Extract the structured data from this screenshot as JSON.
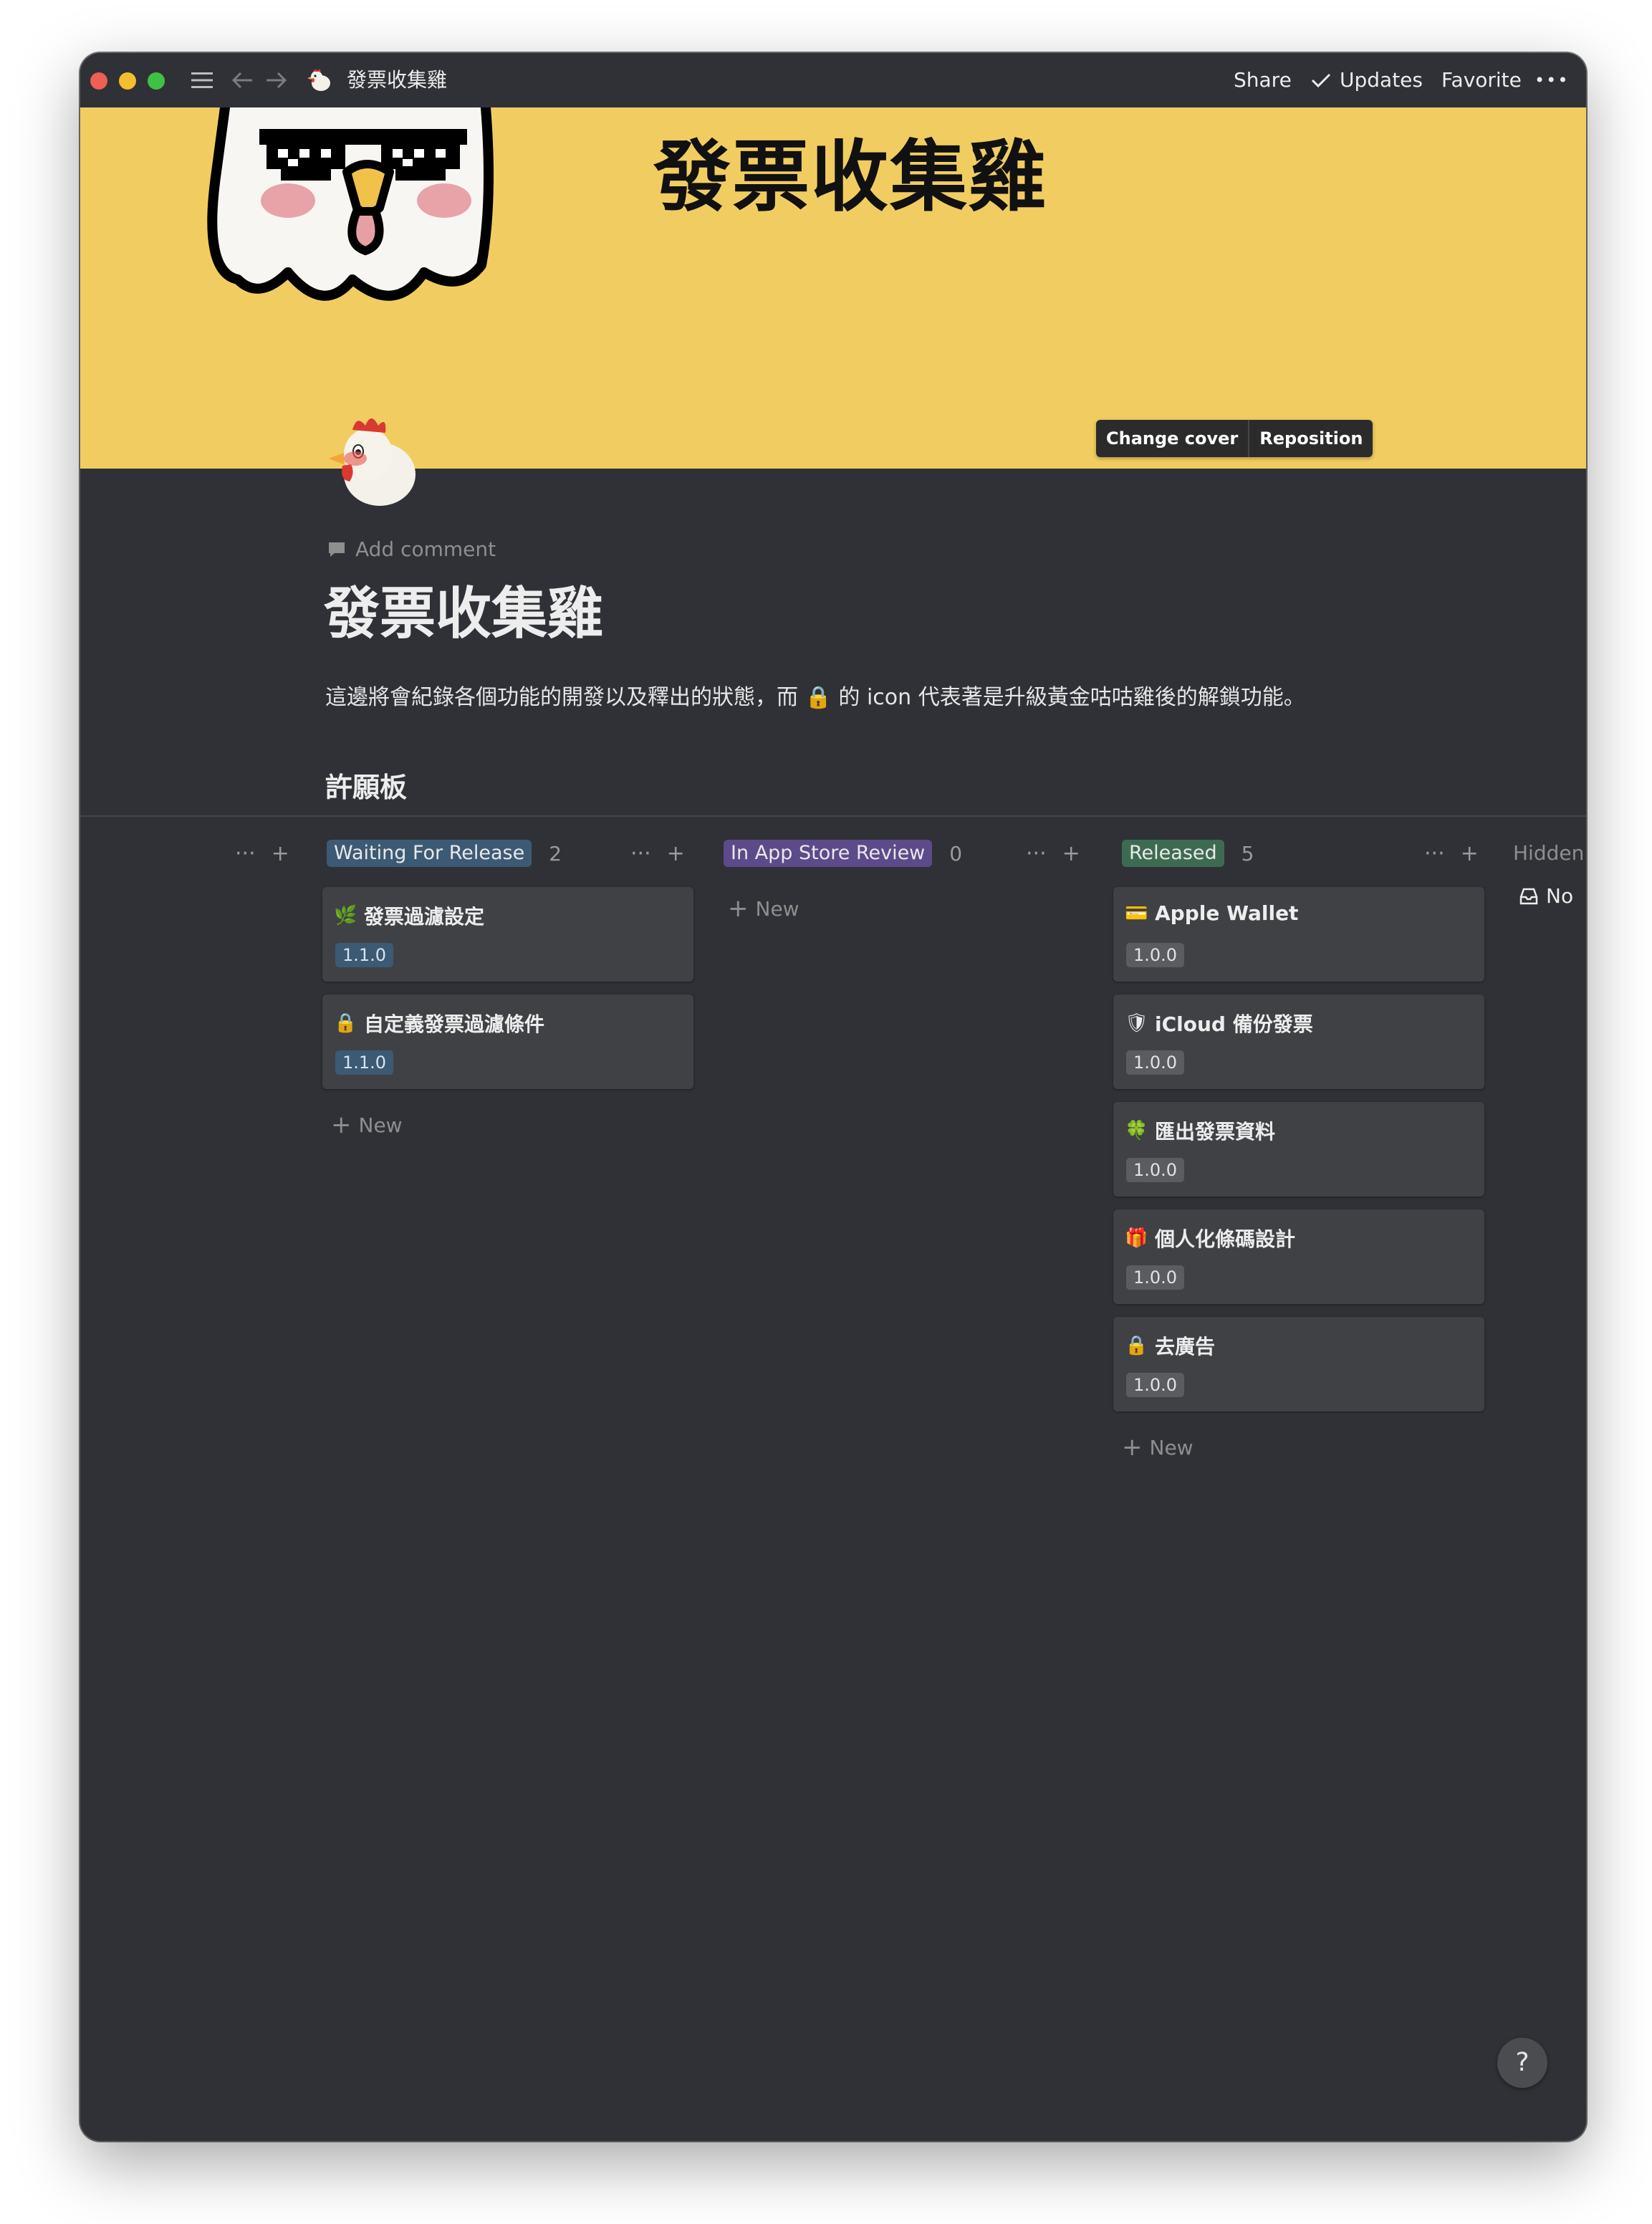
{
  "titlebar": {
    "page_name": "發票收集雞",
    "share": "Share",
    "updates": "Updates",
    "favorite": "Favorite",
    "more": "•••",
    "traffic_colors": [
      "#ee5f56",
      "#f5bd30",
      "#3fc243"
    ]
  },
  "cover": {
    "title": "發票收集雞",
    "change_cover": "Change cover",
    "reposition": "Reposition",
    "background": "#f1cd61"
  },
  "page": {
    "add_comment": "Add comment",
    "title": "發票收集雞",
    "description": "這邊將會紀錄各個功能的開發以及釋出的狀態，而 🔒 的 icon 代表著是升級黃金咕咕雞後的解鎖功能。",
    "board_title": "許願板"
  },
  "board": {
    "columns": [
      {
        "tag": "Waiting For Release",
        "tag_color": "#3c5a74",
        "count": "2",
        "cards": [
          {
            "icon": "🌿",
            "icon_name": "herb-icon",
            "title": "發票過濾設定",
            "version": "1.1.0"
          },
          {
            "icon": "🔒",
            "icon_name": "lock-icon",
            "title": "自定義發票過濾條件",
            "version": "1.1.0"
          }
        ],
        "new_label": "New"
      },
      {
        "tag": "In App Store Review",
        "tag_color": "#5c4a8a",
        "count": "0",
        "cards": [],
        "new_label": "New"
      },
      {
        "tag": "Released",
        "tag_color": "#3d6b52",
        "count": "5",
        "cards": [
          {
            "icon": "💳",
            "icon_name": "credit-card-icon",
            "title": "Apple Wallet",
            "version": "1.0.0"
          },
          {
            "icon": "🛡",
            "icon_name": "shield-icon",
            "title": "iCloud 備份發票",
            "version": "1.0.0"
          },
          {
            "icon": "🍀",
            "icon_name": "clover-icon",
            "title": "匯出發票資料",
            "version": "1.0.0"
          },
          {
            "icon": "🎁",
            "icon_name": "gift-icon",
            "title": "個人化條碼設計",
            "version": "1.0.0"
          },
          {
            "icon": "🔒",
            "icon_name": "lock-icon",
            "title": "去廣告",
            "version": "1.0.0"
          }
        ],
        "new_label": "New"
      }
    ],
    "hidden_label": "Hidden",
    "hidden_card": "No"
  },
  "help": "?"
}
